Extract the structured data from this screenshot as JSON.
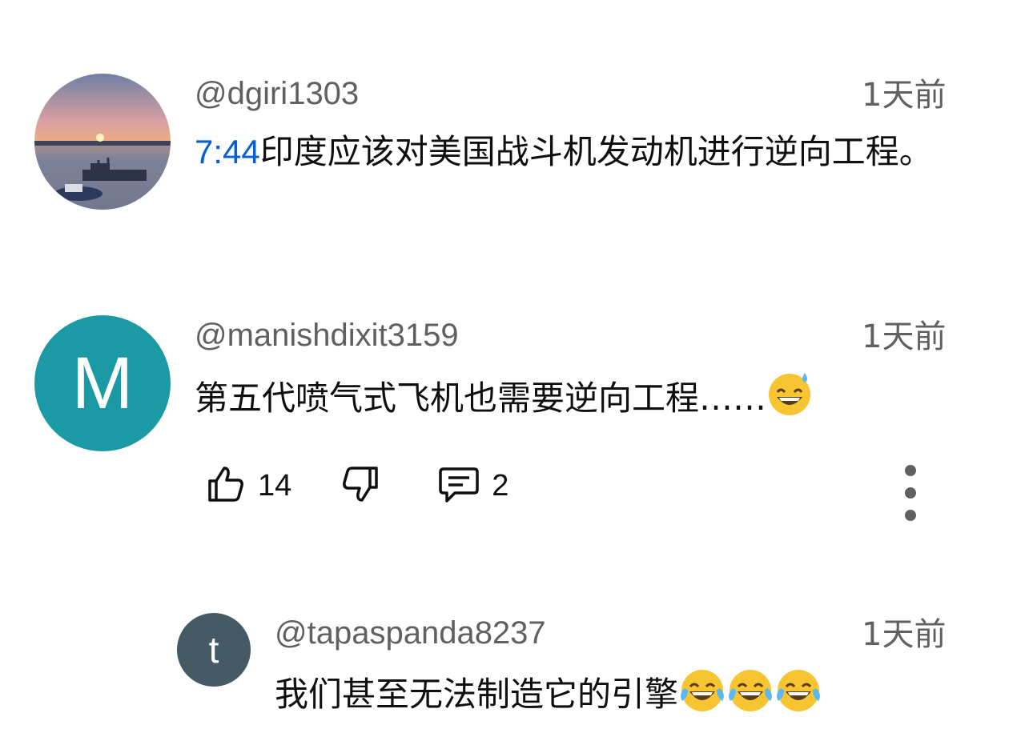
{
  "comments": [
    {
      "handle": "@dgiri1303",
      "time": "1天前",
      "timestamp_link": "7:44",
      "text_after_link": "印度应该对美国战斗机发动机进行逆向工程。",
      "avatar": {
        "type": "photo",
        "description_icon": "sunset-photo-avatar"
      }
    },
    {
      "handle": "@manishdixit3159",
      "time": "1天前",
      "text": "第五代喷气式飞机也需要逆向工程……",
      "emoji": "grinning-face-with-sweat",
      "avatar": {
        "type": "letter",
        "letter": "M",
        "color": "#1b9aa5"
      },
      "likes": "14",
      "replies": "2"
    },
    {
      "handle": "@tapaspanda8237",
      "time": "1天前",
      "text": "我们甚至无法制造它的引擎",
      "emoji": "face-with-tears-of-joy",
      "emoji_count": 3,
      "avatar": {
        "type": "letter",
        "letter": "t",
        "color": "#455a64"
      }
    }
  ],
  "colors": {
    "link": "#065fd4",
    "secondary_text": "#606060",
    "primary_text": "#0f0f0f"
  }
}
